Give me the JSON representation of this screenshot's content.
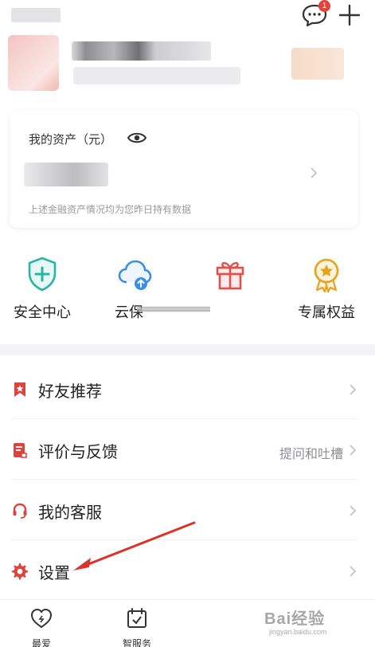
{
  "header": {
    "message_badge_count": "1"
  },
  "assets": {
    "title": "我的资产（元）",
    "note": "上述金融资产情况均为您昨日持有数据"
  },
  "quick_actions": [
    {
      "label": "安全中心",
      "icon": "shield-plus-icon",
      "color": "#2bb3a5"
    },
    {
      "label": "云保",
      "icon": "cloud-upload-icon",
      "color": "#3a8ee6"
    },
    {
      "label": "",
      "icon": "gift-icon",
      "color": "#e2504a"
    },
    {
      "label": "专属权益",
      "icon": "medal-star-icon",
      "color": "#e8a21a"
    }
  ],
  "menu": [
    {
      "label": "好友推荐",
      "hint": "",
      "icon": "bookmark-star-icon"
    },
    {
      "label": "评价与反馈",
      "hint": "提问和吐槽",
      "icon": "feedback-icon"
    },
    {
      "label": "我的客服",
      "hint": "",
      "icon": "headset-icon"
    },
    {
      "label": "设置",
      "hint": "",
      "icon": "gear-icon"
    }
  ],
  "tabbar": [
    {
      "label": "最爱",
      "icon": "heart-icon"
    },
    {
      "label": "智服务",
      "icon": "calendar-check-icon"
    }
  ],
  "watermark": {
    "text": "Bai经验",
    "sub": "jingyan.baidu.com"
  },
  "colors": {
    "accent_red": "#e2433c",
    "icon_red": "#d9453f"
  }
}
